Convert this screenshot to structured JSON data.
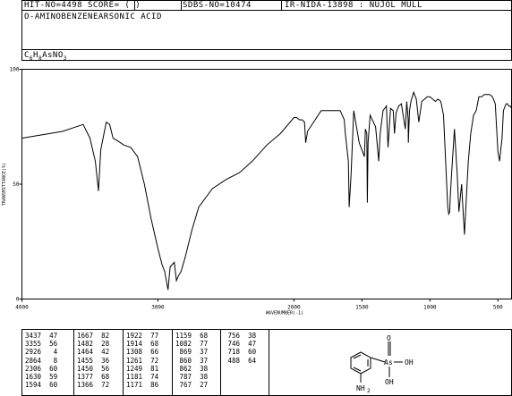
{
  "header": {
    "hit_no": "HIT-NO=4498",
    "score": "SCORE=  (   )",
    "sdbs_no": "SDBS-NO=10474",
    "ir_info": "IR-NIDA-13898 : NUJOL MULL",
    "compound_name": "O-AMINOBENZENEARSONIC ACID",
    "formula_parts": [
      "C",
      "6",
      "H",
      "8",
      "AsNO",
      "3"
    ]
  },
  "chart_data": {
    "type": "line",
    "title": "",
    "xlabel": "WAVENUMBER(-1)",
    "ylabel": "TRANSMITTANCE(%)",
    "xlim": [
      4000,
      400
    ],
    "ylim": [
      0,
      100
    ],
    "x_reversed": true,
    "xticks": [
      4000,
      3000,
      2000,
      1500,
      1000,
      500
    ],
    "xtick_labels": [
      "4000",
      "3000",
      "2000",
      "1500",
      "1000",
      "500"
    ],
    "yticks": [
      0,
      50,
      100
    ],
    "ytick_labels": [
      "0",
      "50",
      "100"
    ],
    "grid": false,
    "series": [
      {
        "x": [
          4000,
          3900,
          3800,
          3700,
          3600,
          3550,
          3500,
          3460,
          3437,
          3420,
          3380,
          3355,
          3330,
          3300,
          3250,
          3200,
          3150,
          3100,
          3050,
          3000,
          2970,
          2950,
          2926,
          2910,
          2880,
          2864,
          2850,
          2830,
          2800,
          2750,
          2700,
          2600,
          2500,
          2400,
          2306,
          2200,
          2100,
          2000,
          1980,
          1960,
          1940,
          1922,
          1914,
          1900,
          1800,
          1700,
          1667,
          1660,
          1630,
          1622,
          1600,
          1594,
          1580,
          1560,
          1520,
          1482,
          1475,
          1464,
          1460,
          1455,
          1440,
          1400,
          1377,
          1366,
          1345,
          1320,
          1308,
          1290,
          1270,
          1261,
          1249,
          1230,
          1210,
          1181,
          1171,
          1160,
          1159,
          1150,
          1140,
          1120,
          1100,
          1082,
          1060,
          1040,
          1020,
          1000,
          980,
          960,
          940,
          920,
          900,
          869,
          862,
          855,
          850,
          840,
          820,
          800,
          787,
          767,
          756,
          746,
          730,
          718,
          700,
          680,
          660,
          640,
          620,
          600,
          560,
          540,
          520,
          500,
          488,
          470,
          460,
          440,
          430,
          420,
          410,
          400
        ],
        "y": [
          70,
          71,
          72,
          73,
          75,
          76,
          70,
          60,
          47,
          65,
          77,
          76,
          70,
          69,
          67,
          66,
          62,
          50,
          35,
          22,
          15,
          12,
          4,
          14,
          16,
          8,
          10,
          12,
          18,
          30,
          40,
          48,
          52,
          55,
          60,
          67,
          72,
          79,
          79,
          78,
          78,
          77,
          68,
          73,
          82,
          82,
          82,
          82,
          78,
          72,
          60,
          40,
          54,
          82,
          68,
          62,
          74,
          72,
          42,
          68,
          80,
          75,
          60,
          72,
          82,
          84,
          66,
          83,
          82,
          72,
          81,
          84,
          85,
          74,
          86,
          78,
          68,
          82,
          86,
          90,
          87,
          77,
          86,
          87,
          88,
          88,
          87,
          86,
          87,
          86,
          80,
          40,
          37,
          38,
          45,
          55,
          74,
          55,
          38,
          50,
          38,
          28,
          47,
          60,
          72,
          80,
          82,
          88,
          88,
          89,
          89,
          88,
          85,
          64,
          60,
          70,
          82,
          85,
          85,
          84,
          84,
          83
        ]
      }
    ]
  },
  "peak_table": {
    "columns": [
      [
        [
          "3437",
          "47"
        ],
        [
          "3355",
          "56"
        ],
        [
          "2926",
          "4"
        ],
        [
          "2864",
          "8"
        ],
        [
          "2306",
          "60"
        ],
        [
          "1630",
          "59"
        ],
        [
          "1594",
          "60"
        ]
      ],
      [
        [
          "1667",
          "82"
        ],
        [
          "1482",
          "28"
        ],
        [
          "1464",
          "42"
        ],
        [
          "1455",
          "36"
        ],
        [
          "1450",
          "56"
        ],
        [
          "1377",
          "68"
        ],
        [
          "1366",
          "72"
        ]
      ],
      [
        [
          "1922",
          "77"
        ],
        [
          "1914",
          "68"
        ],
        [
          "1308",
          "66"
        ],
        [
          "1261",
          "72"
        ],
        [
          "1249",
          "81"
        ],
        [
          "1181",
          "74"
        ],
        [
          "1171",
          "86"
        ]
      ],
      [
        [
          "1159",
          "68"
        ],
        [
          "1082",
          "77"
        ],
        [
          "869",
          "37"
        ],
        [
          "860",
          "37"
        ],
        [
          "862",
          "38"
        ],
        [
          "787",
          "38"
        ],
        [
          "767",
          "27"
        ]
      ],
      [
        [
          "756",
          "38"
        ],
        [
          "746",
          "47"
        ],
        [
          "718",
          "60"
        ],
        [
          "488",
          "64"
        ]
      ]
    ]
  },
  "structure": {
    "atom_labels": [
      "O",
      "As",
      "OH",
      "OH",
      "NH",
      "2"
    ]
  }
}
